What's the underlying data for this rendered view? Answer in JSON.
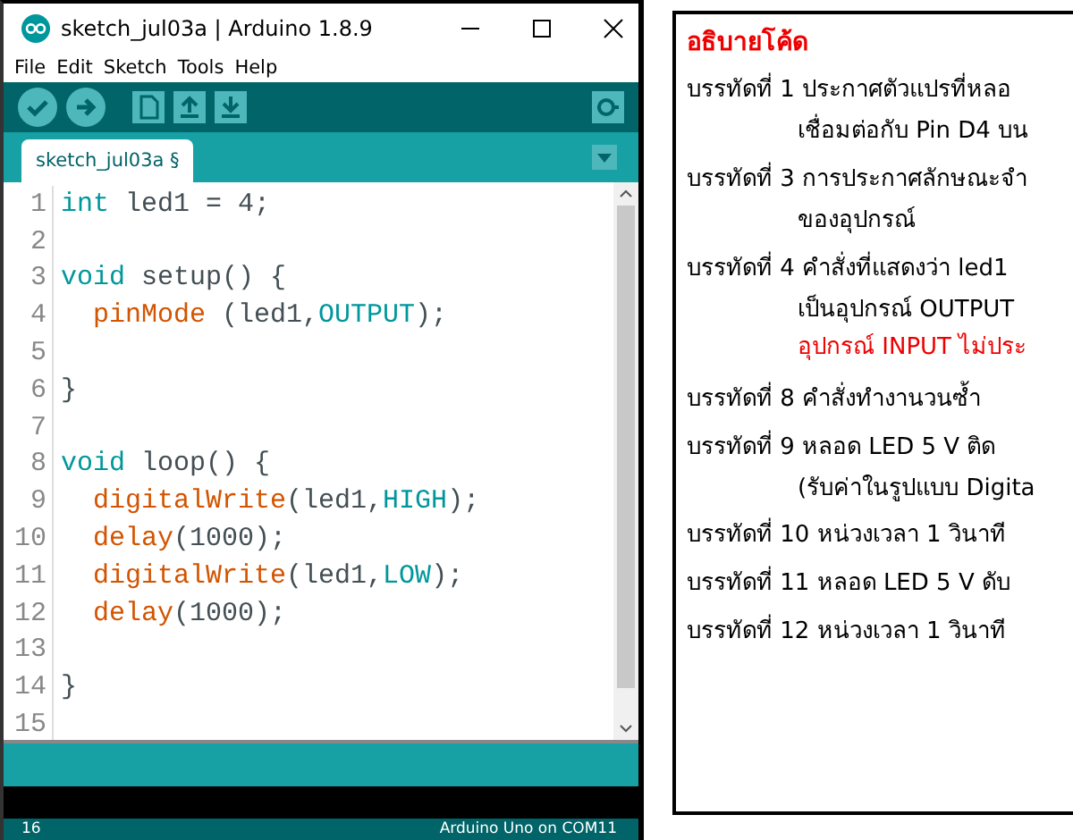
{
  "window": {
    "title": "sketch_jul03a | Arduino 1.8.9"
  },
  "menu": [
    "File",
    "Edit",
    "Sketch",
    "Tools",
    "Help"
  ],
  "tabs": [
    {
      "label": "sketch_jul03a §",
      "selected": true
    }
  ],
  "code": [
    {
      "number": "1",
      "tokens": [
        {
          "kind": "type",
          "text": "int"
        },
        {
          "kind": "plain",
          "text": " led1 = 4;"
        }
      ]
    },
    {
      "number": "2"
    },
    {
      "number": "3",
      "tokens": [
        {
          "kind": "type",
          "text": "void"
        },
        {
          "kind": "plain",
          "text": " setup() {"
        }
      ]
    },
    {
      "number": "4",
      "indent": true,
      "tokens": [
        {
          "kind": "func",
          "text": "pinMode"
        },
        {
          "kind": "plain",
          "text": " (led1,"
        },
        {
          "kind": "const",
          "text": "OUTPUT"
        },
        {
          "kind": "plain",
          "text": ");"
        }
      ]
    },
    {
      "number": "5"
    },
    {
      "number": "6",
      "tokens": [
        {
          "kind": "plain",
          "text": "}"
        }
      ]
    },
    {
      "number": "7"
    },
    {
      "number": "8",
      "tokens": [
        {
          "kind": "type",
          "text": "void"
        },
        {
          "kind": "plain",
          "text": " loop() {"
        }
      ]
    },
    {
      "number": "9",
      "indent": true,
      "tokens": [
        {
          "kind": "func",
          "text": "digitalWrite"
        },
        {
          "kind": "plain",
          "text": "(led1,"
        },
        {
          "kind": "const",
          "text": "HIGH"
        },
        {
          "kind": "plain",
          "text": ");"
        }
      ]
    },
    {
      "number": "10",
      "indent": true,
      "tokens": [
        {
          "kind": "func",
          "text": "delay"
        },
        {
          "kind": "plain",
          "text": "(1000);"
        }
      ]
    },
    {
      "number": "11",
      "indent": true,
      "tokens": [
        {
          "kind": "func",
          "text": "digitalWrite"
        },
        {
          "kind": "plain",
          "text": "(led1,"
        },
        {
          "kind": "const",
          "text": "LOW"
        },
        {
          "kind": "plain",
          "text": ");"
        }
      ]
    },
    {
      "number": "12",
      "indent": true,
      "tokens": [
        {
          "kind": "func",
          "text": "delay"
        },
        {
          "kind": "plain",
          "text": "(1000);"
        }
      ]
    },
    {
      "number": "13"
    },
    {
      "number": "14",
      "tokens": [
        {
          "kind": "plain",
          "text": "}"
        }
      ]
    },
    {
      "number": "15"
    }
  ],
  "status_bar": {
    "line": "16",
    "board": "Arduino Uno on COM11"
  },
  "explanation": [
    {
      "kind": "heading",
      "text": "อธิบายโค้ด"
    },
    {
      "kind": "line",
      "text": "บรรทัดที่ 1 ประกาศตัวแปรที่หลอ"
    },
    {
      "kind": "continuation",
      "text": "เชื่อมต่อกับ Pin D4 บน"
    },
    {
      "kind": "line",
      "text": "บรรทัดที่ 3 การประกาศลักษณะจำ"
    },
    {
      "kind": "continuation",
      "text": "ของอุปกรณ์"
    },
    {
      "kind": "line",
      "text": "บรรทัดที่ 4 คำสั่งที่แสดงว่า led1"
    },
    {
      "kind": "continuation",
      "text": "เป็นอุปกรณ์ OUTPUT"
    },
    {
      "kind": "warning",
      "text": "อุปกรณ์ INPUT ไม่ประ"
    },
    {
      "kind": "line",
      "text": "บรรทัดที่ 8 คำสั่งทำงานวนซ้ำ"
    },
    {
      "kind": "line",
      "text": "บรรทัดที่ 9 หลอด LED 5 V ติด"
    },
    {
      "kind": "continuation",
      "text": "(รับค่าในรูปแบบ Digita"
    },
    {
      "kind": "line",
      "text": "บรรทัดที่ 10 หน่วงเวลา 1 วินาที"
    },
    {
      "kind": "line",
      "text": "บรรทัดที่ 11 หลอด LED 5 V ดับ"
    },
    {
      "kind": "line",
      "text": "บรรทัดที่ 12 หน่วงเวลา 1 วินาที"
    }
  ]
}
